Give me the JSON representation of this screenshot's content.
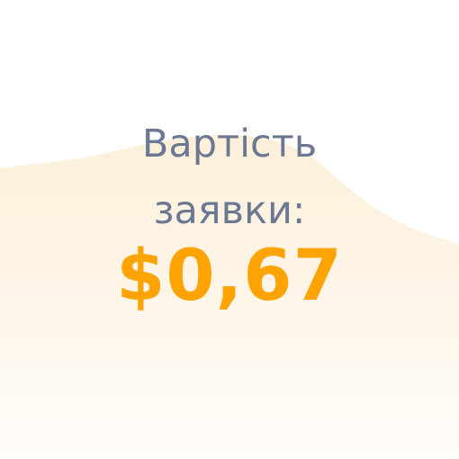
{
  "card": {
    "label_line1": "Вартість",
    "label_line2": "заявки:",
    "price": "$0,67"
  },
  "colors": {
    "label": "#6c7893",
    "price": "#ffa300",
    "background_wave": "#fdf1dc"
  }
}
